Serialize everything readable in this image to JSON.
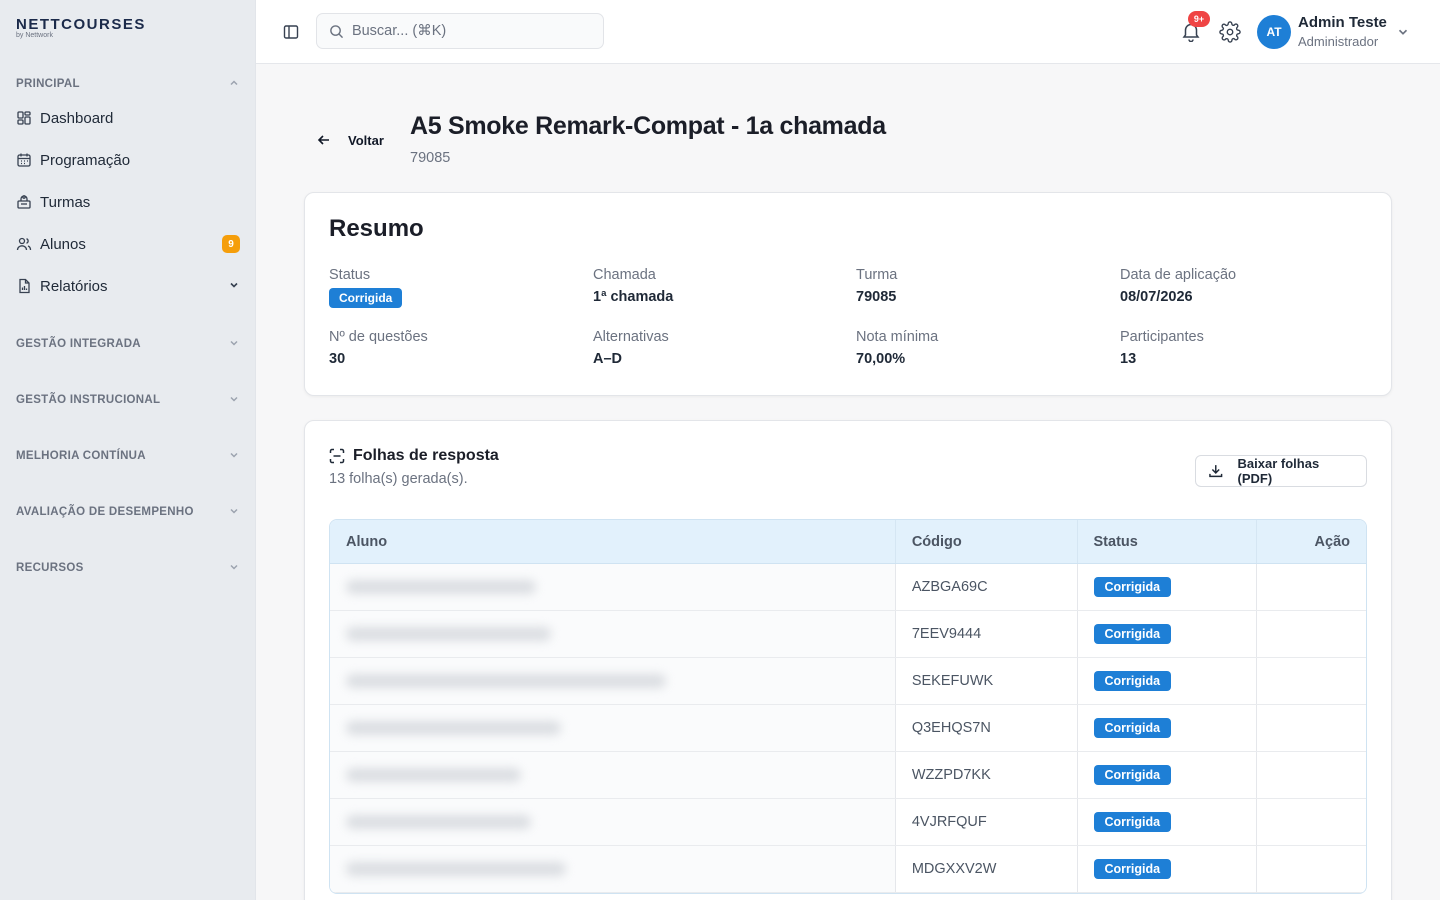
{
  "brand": {
    "name_part1": "NETT",
    "name_part2": "COURSES",
    "sub": "by Nettwork"
  },
  "sidebar": {
    "sections": [
      {
        "label": "PRINCIPAL",
        "expanded": true
      },
      {
        "label": "GESTÃO INTEGRADA",
        "expanded": false
      },
      {
        "label": "GESTÃO INSTRUCIONAL",
        "expanded": false
      },
      {
        "label": "MELHORIA CONTÍNUA",
        "expanded": false
      },
      {
        "label": "AVALIAÇÃO DE DESEMPENHO",
        "expanded": false
      },
      {
        "label": "RECURSOS",
        "expanded": false
      }
    ],
    "items": [
      {
        "label": "Dashboard",
        "icon": "dashboard-icon"
      },
      {
        "label": "Programação",
        "icon": "calendar-icon"
      },
      {
        "label": "Turmas",
        "icon": "classes-icon"
      },
      {
        "label": "Alunos",
        "icon": "users-icon",
        "badge": "9"
      },
      {
        "label": "Relatórios",
        "icon": "report-icon"
      }
    ]
  },
  "header": {
    "search_placeholder": "Buscar... (⌘K)",
    "notifications_badge": "9+",
    "user": {
      "initials": "AT",
      "name": "Admin Teste",
      "role": "Administrador"
    }
  },
  "page": {
    "back_label": "Voltar",
    "title": "A5 Smoke Remark-Compat - 1a chamada",
    "code": "79085"
  },
  "summary": {
    "title": "Resumo",
    "fields": [
      {
        "label": "Status",
        "value": "Corrigida"
      },
      {
        "label": "Chamada",
        "value": "1ª chamada"
      },
      {
        "label": "Turma",
        "value": "79085"
      },
      {
        "label": "Data de aplicação",
        "value": "08/07/2026"
      },
      {
        "label": "Nº de questões",
        "value": "30"
      },
      {
        "label": "Alternativas",
        "value": "A–D"
      },
      {
        "label": "Nota mínima",
        "value": "70,00%"
      },
      {
        "label": "Participantes",
        "value": "13"
      }
    ]
  },
  "sheets": {
    "title": "Folhas de resposta",
    "subtitle": "13 folha(s) gerada(s).",
    "download_label": "Baixar folhas (PDF)",
    "columns": [
      "Aluno",
      "Código",
      "Status",
      "Ação"
    ],
    "rows": [
      {
        "code": "AZBGA69C",
        "status": "Corrigida"
      },
      {
        "code": "7EEV9444",
        "status": "Corrigida"
      },
      {
        "code": "SEKEFUWK",
        "status": "Corrigida"
      },
      {
        "code": "Q3EHQS7N",
        "status": "Corrigida"
      },
      {
        "code": "WZZPD7KK",
        "status": "Corrigida"
      },
      {
        "code": "4VJRFQUF",
        "status": "Corrigida"
      },
      {
        "code": "MDGXXV2W",
        "status": "Corrigida"
      }
    ]
  },
  "colors": {
    "accent": "#1e7fd6",
    "badge_orange": "#f59e0b",
    "notif_red": "#ef4444",
    "table_header_bg": "#e2f1fc"
  }
}
